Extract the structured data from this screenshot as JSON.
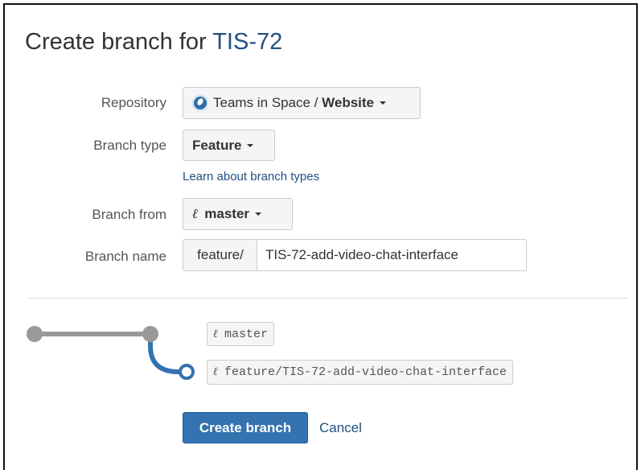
{
  "dialog": {
    "title_prefix": "Create branch for ",
    "issue_key": "TIS-72"
  },
  "form": {
    "repository": {
      "label": "Repository",
      "project": "Teams in Space",
      "separator": " / ",
      "repo": "Website",
      "icon": "repository-icon"
    },
    "branch_type": {
      "label": "Branch type",
      "value": "Feature",
      "help_link": "Learn about branch types"
    },
    "branch_from": {
      "label": "Branch from",
      "glyph": "ℓ",
      "value": "master",
      "icon": "branch-icon"
    },
    "branch_name": {
      "label": "Branch name",
      "prefix": "feature/",
      "value": "TIS-72-add-video-chat-interface"
    }
  },
  "diagram": {
    "glyph": "ℓ",
    "source_branch": "master",
    "new_branch": "feature/TIS-72-add-video-chat-interface",
    "colors": {
      "source_line": "#999999",
      "new_line": "#3572b0"
    }
  },
  "actions": {
    "create_label": "Create branch",
    "cancel_label": "Cancel"
  }
}
